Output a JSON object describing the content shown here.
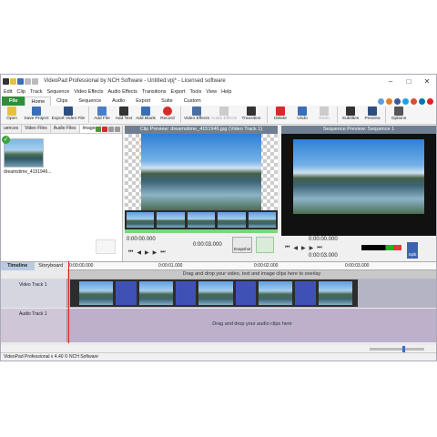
{
  "window": {
    "title": "VideoPad Professional by NCH Software - Untitled.vpj* - Licensed software",
    "controls": [
      "–",
      "□",
      "✕"
    ]
  },
  "menu": [
    "Edit",
    "Clip",
    "Track",
    "Sequence",
    "Video Effects",
    "Audio Effects",
    "Transitions",
    "Export",
    "Tools",
    "View",
    "Help"
  ],
  "ribbon_tabs": [
    "File",
    "Home",
    "Clips",
    "Sequence",
    "Audio",
    "Export",
    "Suite",
    "Custom"
  ],
  "ribbon": {
    "open": "Open",
    "save_project": "Save Project",
    "export_video": "Export Video File",
    "add_file": "Add File",
    "add_text": "Add Text",
    "add_blank": "Add Blank",
    "record": "Record",
    "video_effects": "Video Effects",
    "audio_effects": "Audio Effects",
    "transition": "Transition",
    "delete": "Delete",
    "undo": "Undo",
    "redo": "Redo",
    "subtitles": "Subtitles",
    "preview": "Preview",
    "options": "Options"
  },
  "bin": {
    "tabs": [
      "uences",
      "Video Files",
      "Audio Files",
      "Images"
    ],
    "clip_label": "dreamstime_4151946..."
  },
  "clip_preview": {
    "title": "Clip Preview: dreamstime_4151946.jpg (Video Track 1)",
    "time_current": "0:00:00.000",
    "time_end": "0:00:03.000",
    "snapshot": "Snapshot"
  },
  "sequence_preview": {
    "title": "Sequence Preview: Sequence 1",
    "time_current": "0:00:00.000",
    "time_end": "0:00:03.000",
    "split": "Split"
  },
  "timeline": {
    "tab_timeline": "Timeline",
    "tab_storyboard": "Storyboard",
    "ruler": [
      "0:00:00.000",
      "0:00:01.000",
      "0:00:02.000",
      "0:00:03.000"
    ],
    "overlay_hint": "Drag and drop your video, text and image clips here to overlay",
    "video_track": "Video Track 1",
    "audio_track": "Audio Track 1",
    "audio_hint": "Drag and drop your audio clips here"
  },
  "status": "VideoPad Professional v 4.40 © NCH Software"
}
